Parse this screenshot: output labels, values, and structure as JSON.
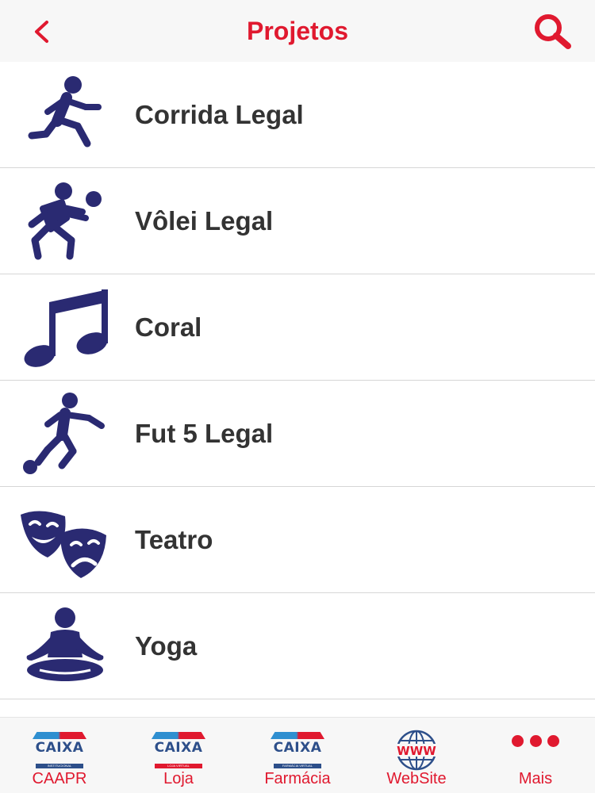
{
  "nav": {
    "title": "Projetos",
    "back_icon": "chevron-left-icon",
    "search_icon": "search-icon"
  },
  "colors": {
    "accent": "#e0192f",
    "icon_navy": "#2a2a72",
    "text": "#333333",
    "bar_bg": "#f7f7f7",
    "divider": "#d6d6d6"
  },
  "items": [
    {
      "label": "Corrida Legal",
      "icon": "running-person-icon"
    },
    {
      "label": "Vôlei Legal",
      "icon": "volleyball-player-icon"
    },
    {
      "label": "Coral",
      "icon": "music-note-icon"
    },
    {
      "label": "Fut 5 Legal",
      "icon": "soccer-player-icon"
    },
    {
      "label": "Teatro",
      "icon": "theater-masks-icon"
    },
    {
      "label": "Yoga",
      "icon": "yoga-meditation-icon"
    }
  ],
  "tabs": [
    {
      "label": "CAAPR",
      "icon": "caixa-institucional-logo-icon",
      "logo_text": "CAIXA",
      "logo_sub": "INSTITUCIONAL"
    },
    {
      "label": "Loja",
      "icon": "caixa-loja-virtual-logo-icon",
      "logo_text": "CAIXA",
      "logo_sub": "LOJA VIRTUAL"
    },
    {
      "label": "Farmácia",
      "icon": "caixa-farmacia-virtual-logo-icon",
      "logo_text": "CAIXA",
      "logo_sub": "FARMÁCIA VIRTUAL"
    },
    {
      "label": "WebSite",
      "icon": "globe-www-icon",
      "logo_text": "WWW"
    },
    {
      "label": "Mais",
      "icon": "more-dots-icon"
    }
  ]
}
